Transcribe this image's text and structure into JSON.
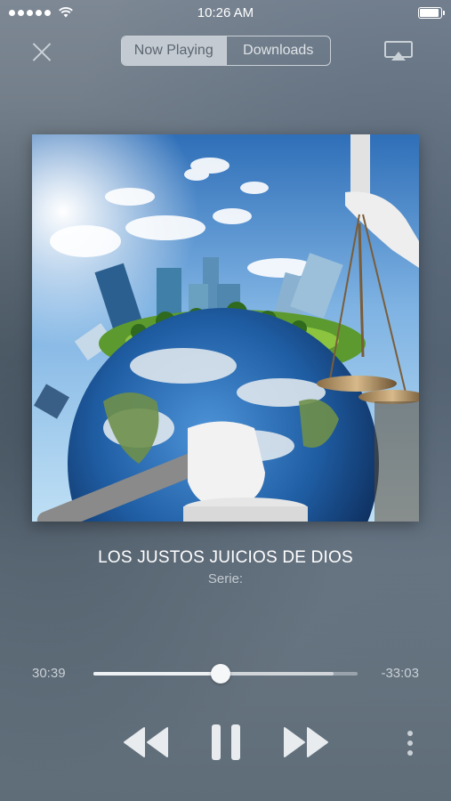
{
  "status_bar": {
    "time": "10:26 AM"
  },
  "nav": {
    "tabs": [
      {
        "label": "Now Playing",
        "active": true
      },
      {
        "label": "Downloads",
        "active": false
      }
    ]
  },
  "track": {
    "title": "LOS JUSTOS JUICIOS DE DIOS",
    "series": "Serie:"
  },
  "playback": {
    "elapsed": "30:39",
    "remaining": "-33:03",
    "progress_fraction": 0.48,
    "buffered_fraction": 0.91
  },
  "icons": [
    "close-icon",
    "airplay-icon",
    "rewind-icon",
    "pause-icon",
    "fast-forward-icon",
    "more-vertical-icon"
  ],
  "colors": {
    "active_segment": "#c3cad1",
    "accent": "#ffffff"
  }
}
